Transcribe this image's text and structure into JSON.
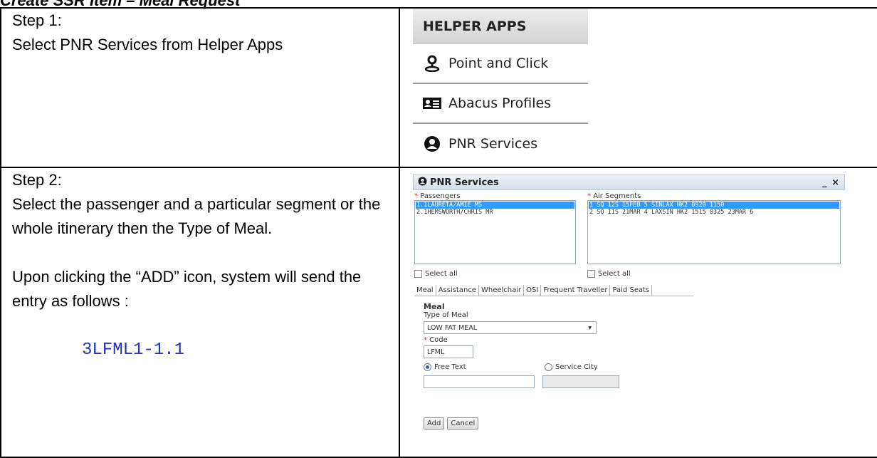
{
  "document": {
    "title": "Create SSR Item – Meal Request"
  },
  "step1": {
    "heading": "Step 1:",
    "instruction": "Select PNR Services from Helper Apps"
  },
  "helper_apps": {
    "header": "HELPER APPS",
    "items": [
      {
        "label": "Point and Click",
        "icon": "location-person-icon"
      },
      {
        "label": "Abacus Profiles",
        "icon": "id-card-icon"
      },
      {
        "label": "PNR Services",
        "icon": "user-circle-icon"
      }
    ]
  },
  "step2": {
    "heading": "Step 2:",
    "instruction": "Select the passenger and a particular segment or the whole itinerary then the Type of Meal.",
    "add_note": "Upon clicking the “ADD” icon, system will send the entry as follows :",
    "command": "3LFML1-1.1"
  },
  "pnr_window": {
    "title": "PNR Services",
    "window_controls": "_ ×",
    "passengers_label": "Passengers",
    "passengers": [
      {
        "text": "1.1LAURETA/AMIE MS",
        "selected": true
      },
      {
        "text": "2.1HEMSWORTH/CHRIS MR",
        "selected": false
      }
    ],
    "segments_label": "Air Segments",
    "segments": [
      {
        "text": "1 SQ  12S 15FEB 5 SINLAX HK2  0920  1150",
        "selected": true
      },
      {
        "text": "2 SQ  11S 21MAR 4 LAXSIN HK2  1515  0325  23MAR 6",
        "selected": false
      }
    ],
    "select_all_label": "Select all",
    "tabs": [
      "Meal",
      "Assistance",
      "Wheelchair",
      "OSI",
      "Frequent Traveller",
      "Paid Seats"
    ],
    "meal_section_title": "Meal",
    "type_of_meal_label": "Type of Meal",
    "type_of_meal_value": "LOW FAT MEAL",
    "code_label": "Code",
    "code_value": "LFML",
    "free_text_label": "Free Text",
    "service_city_label": "Service City",
    "add_button": "Add",
    "cancel_button": "Cancel",
    "required_marker": "*"
  }
}
